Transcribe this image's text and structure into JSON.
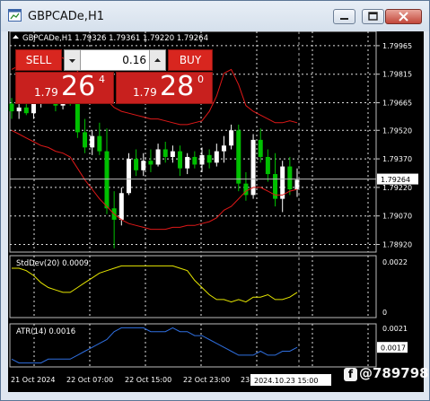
{
  "window": {
    "title": "GBPCADe,H1"
  },
  "chart_header": {
    "ohlc": "GBPCADe,H1  1.79326 1.79361 1.79220 1.79264"
  },
  "trade_panel": {
    "sell_label": "SELL",
    "buy_label": "BUY",
    "volume": "0.16",
    "sell_price_small": "1.79",
    "sell_price_big": "26",
    "sell_price_sup": "4",
    "buy_price_small": "1.79",
    "buy_price_big": "28",
    "buy_price_sup": "0"
  },
  "price_axis": {
    "ticks": [
      "1.79965",
      "1.79815",
      "1.79665",
      "1.79520",
      "1.79370",
      "1.79220",
      "1.79070",
      "1.78920"
    ],
    "current": "1.79264"
  },
  "stddev": {
    "label": "StdDev(20) 0.0009",
    "ticks": [
      "0.0022",
      "0"
    ]
  },
  "atr": {
    "label": "ATR(14) 0.0016",
    "ticks": [
      "0.0021",
      "0.0017"
    ]
  },
  "time_axis": {
    "labels": [
      "21 Oct 2024",
      "22 Oct 07:00",
      "22 Oct 15:00",
      "22 Oct 23:00",
      "23 Oct"
    ],
    "cursor_label": "2024.10.23 15:00"
  },
  "watermark": "@789798",
  "colors": {
    "bull": "#ffffff",
    "bear": "#00c000",
    "bands": "#e01818",
    "stddev": "#e6e600",
    "atr": "#2f6fe0",
    "grid": "#e0e0e0",
    "sell_bg": "#c8201e"
  },
  "chart_data": {
    "type": "candlestick",
    "symbol": "GBPCADe",
    "timeframe": "H1",
    "ylim": [
      1.7888,
      1.8004
    ],
    "candles": [
      [
        1.7966,
        1.7969,
        1.7958,
        1.7962
      ],
      [
        1.7962,
        1.7966,
        1.7958,
        1.7964
      ],
      [
        1.7964,
        1.7968,
        1.796,
        1.7961
      ],
      [
        1.7961,
        1.7968,
        1.7958,
        1.7966
      ],
      [
        1.7966,
        1.7974,
        1.7964,
        1.7972
      ],
      [
        1.7972,
        1.7974,
        1.7966,
        1.7968
      ],
      [
        1.7968,
        1.7972,
        1.7962,
        1.7965
      ],
      [
        1.7965,
        1.7976,
        1.7963,
        1.7973
      ],
      [
        1.7973,
        1.7976,
        1.7965,
        1.7967
      ],
      [
        1.7967,
        1.7971,
        1.7948,
        1.7951
      ],
      [
        1.7951,
        1.7958,
        1.794,
        1.7943
      ],
      [
        1.7943,
        1.7952,
        1.7939,
        1.7949
      ],
      [
        1.7949,
        1.7956,
        1.7939,
        1.7941
      ],
      [
        1.7941,
        1.7953,
        1.7908,
        1.7911
      ],
      [
        1.7911,
        1.792,
        1.789,
        1.7905
      ],
      [
        1.7905,
        1.7922,
        1.7902,
        1.7919
      ],
      [
        1.7919,
        1.794,
        1.7918,
        1.7937
      ],
      [
        1.7937,
        1.7942,
        1.7928,
        1.7931
      ],
      [
        1.7931,
        1.794,
        1.7928,
        1.7936
      ],
      [
        1.7936,
        1.7942,
        1.793,
        1.7934
      ],
      [
        1.7934,
        1.7945,
        1.7933,
        1.7942
      ],
      [
        1.7942,
        1.7946,
        1.7935,
        1.7938
      ],
      [
        1.7938,
        1.7944,
        1.7935,
        1.7941
      ],
      [
        1.7941,
        1.7944,
        1.7928,
        1.7932
      ],
      [
        1.7932,
        1.794,
        1.7929,
        1.7938
      ],
      [
        1.7938,
        1.7941,
        1.7932,
        1.7934
      ],
      [
        1.7934,
        1.7943,
        1.793,
        1.7939
      ],
      [
        1.7939,
        1.7942,
        1.7932,
        1.7935
      ],
      [
        1.7935,
        1.7945,
        1.7933,
        1.7941
      ],
      [
        1.7941,
        1.7949,
        1.7935,
        1.7944
      ],
      [
        1.7944,
        1.7955,
        1.7942,
        1.7952
      ],
      [
        1.7952,
        1.7955,
        1.792,
        1.7924
      ],
      [
        1.7924,
        1.793,
        1.7915,
        1.7918
      ],
      [
        1.7918,
        1.795,
        1.7916,
        1.7947
      ],
      [
        1.7947,
        1.7953,
        1.7935,
        1.7938
      ],
      [
        1.7938,
        1.7942,
        1.7925,
        1.7929
      ],
      [
        1.7929,
        1.794,
        1.7912,
        1.7916
      ],
      [
        1.7916,
        1.7936,
        1.7909,
        1.7933
      ],
      [
        1.7933,
        1.7938,
        1.7918,
        1.7921
      ],
      [
        1.7921,
        1.7932,
        1.7917,
        1.7926
      ]
    ],
    "bollinger_upper": [
      1.7984,
      1.7986,
      1.7988,
      1.799,
      1.7992,
      1.7992,
      1.7991,
      1.799,
      1.7988,
      1.7983,
      1.7978,
      1.7975,
      1.7972,
      1.7968,
      1.7964,
      1.7962,
      1.7961,
      1.796,
      1.7959,
      1.7958,
      1.7958,
      1.7957,
      1.7956,
      1.7955,
      1.7955,
      1.7956,
      1.7957,
      1.7962,
      1.797,
      1.7982,
      1.7984,
      1.7976,
      1.7965,
      1.7962,
      1.796,
      1.7958,
      1.7956,
      1.7956,
      1.7957,
      1.7956
    ],
    "bollinger_lower": [
      1.7952,
      1.795,
      1.7948,
      1.7946,
      1.7944,
      1.7943,
      1.7941,
      1.794,
      1.7938,
      1.7932,
      1.7926,
      1.7921,
      1.7916,
      1.7912,
      1.7908,
      1.7905,
      1.7903,
      1.7902,
      1.7901,
      1.79,
      1.79,
      1.79,
      1.7901,
      1.7901,
      1.7902,
      1.7902,
      1.7903,
      1.7904,
      1.7906,
      1.791,
      1.7912,
      1.7916,
      1.792,
      1.7922,
      1.7922,
      1.792,
      1.7918,
      1.7918,
      1.792,
      1.7921
    ],
    "stddev": [
      0.0019,
      0.0019,
      0.0018,
      0.0016,
      0.0013,
      0.0011,
      0.001,
      0.0009,
      0.0009,
      0.0011,
      0.0013,
      0.0015,
      0.0017,
      0.0018,
      0.0019,
      0.002,
      0.002,
      0.002,
      0.002,
      0.002,
      0.002,
      0.002,
      0.002,
      0.0019,
      0.0018,
      0.0014,
      0.0011,
      0.0008,
      0.0006,
      0.0006,
      0.0005,
      0.0006,
      0.0005,
      0.0007,
      0.0007,
      0.0008,
      0.0006,
      0.0006,
      0.0007,
      0.0009
    ],
    "atr": [
      0.0014,
      0.0013,
      0.0013,
      0.0013,
      0.0013,
      0.0014,
      0.0014,
      0.0014,
      0.0014,
      0.0015,
      0.0016,
      0.0017,
      0.0018,
      0.0019,
      0.0021,
      0.0022,
      0.0022,
      0.0022,
      0.0022,
      0.0021,
      0.0021,
      0.0021,
      0.0022,
      0.0021,
      0.0021,
      0.002,
      0.002,
      0.0019,
      0.0018,
      0.0017,
      0.0016,
      0.0015,
      0.0015,
      0.0015,
      0.0016,
      0.0015,
      0.0015,
      0.0016,
      0.0016,
      0.0017
    ],
    "current_price": 1.79264
  }
}
